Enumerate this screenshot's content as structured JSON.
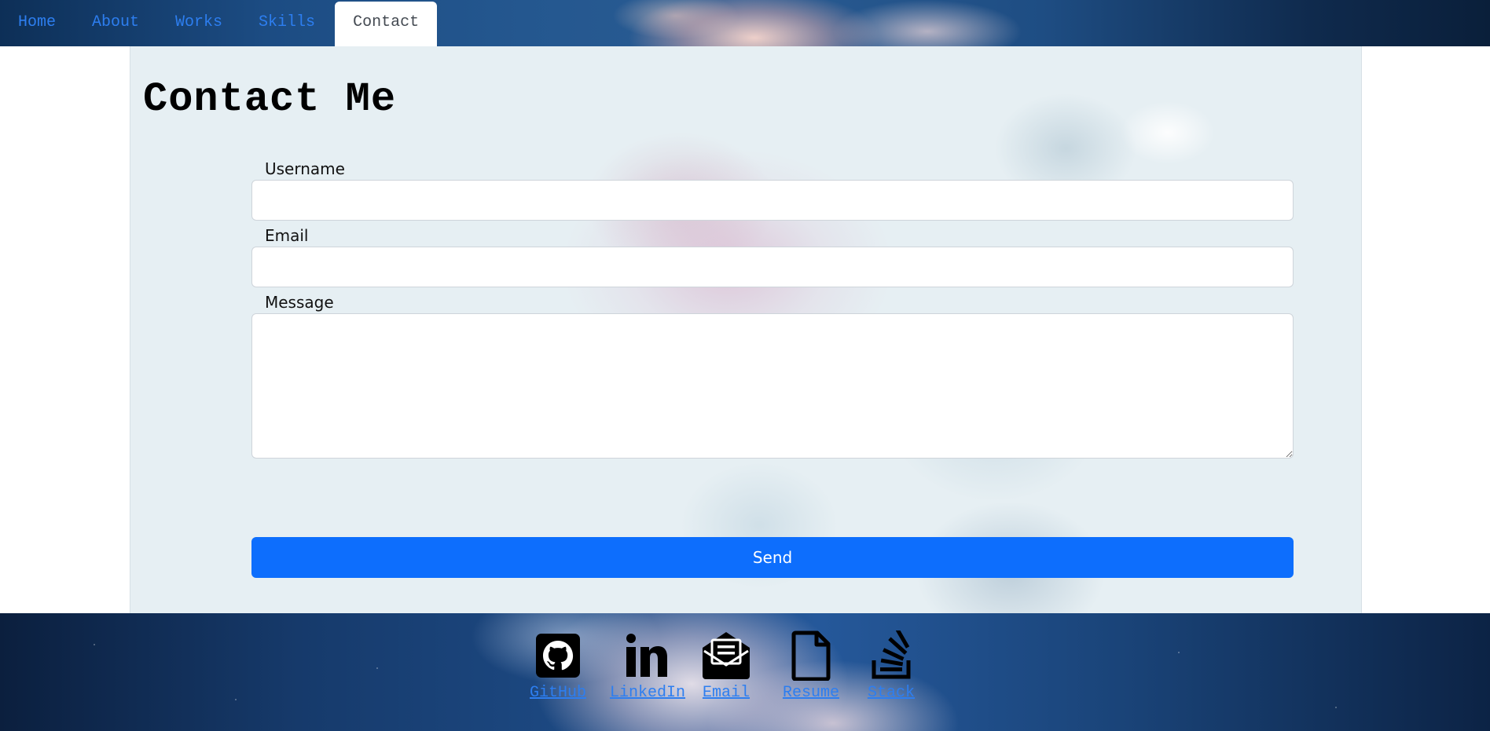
{
  "nav": {
    "tabs": [
      {
        "label": "Home"
      },
      {
        "label": "About"
      },
      {
        "label": "Works"
      },
      {
        "label": "Skills"
      },
      {
        "label": "Contact",
        "active": true
      }
    ]
  },
  "contact": {
    "title": "Contact Me",
    "username_label": "Username",
    "username_value": "",
    "email_label": "Email",
    "email_value": "",
    "message_label": "Message",
    "message_value": "",
    "send_label": "Send"
  },
  "footer": {
    "links": [
      {
        "label": "GitHub",
        "icon": "github-icon"
      },
      {
        "label": "LinkedIn",
        "icon": "linkedin-icon"
      },
      {
        "label": "Email",
        "icon": "envelope-open-icon"
      },
      {
        "label": "Resume",
        "icon": "document-icon"
      },
      {
        "label": "Stack",
        "icon": "stack-overflow-icon"
      }
    ]
  },
  "colors": {
    "accent": "#0d6efd",
    "link": "#2d7ef0",
    "nav_bg": "#1c4c83",
    "panel_bg": "#e6eff3"
  }
}
